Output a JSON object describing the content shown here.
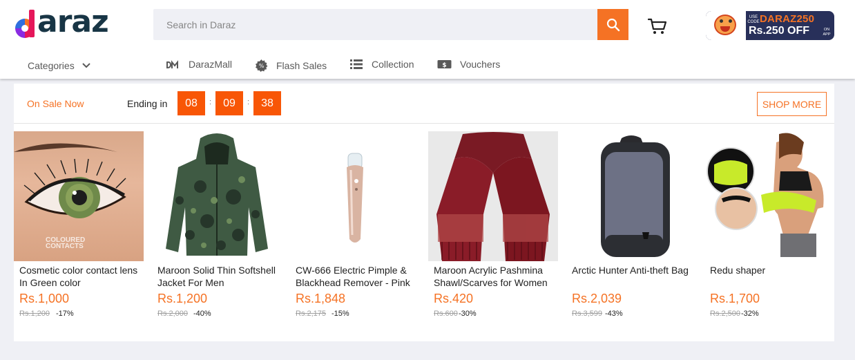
{
  "header": {
    "logo_text": "daraz",
    "search_placeholder": "Search in Daraz",
    "promo": {
      "use_code": "USE CODE",
      "code": "DARAZ250",
      "offer": "Rs.250 OFF",
      "on_app": "ON APP"
    }
  },
  "nav": {
    "categories_label": "Categories",
    "items": [
      {
        "label": "DarazMall",
        "icon": "darazmall-icon"
      },
      {
        "label": "Flash Sales",
        "icon": "flash-sale-icon"
      },
      {
        "label": "Collection",
        "icon": "collection-list-icon"
      },
      {
        "label": "Vouchers",
        "icon": "voucher-icon"
      }
    ]
  },
  "flash_sale": {
    "on_sale_label": "On Sale Now",
    "ending_label": "Ending in",
    "timer": {
      "hours": "08",
      "minutes": "09",
      "seconds": "38"
    },
    "separator": ":",
    "shop_more_label": "SHOP MORE"
  },
  "products": [
    {
      "name": "Cosmetic color contact lens In Green color",
      "price": "Rs.1,000",
      "original_price": "Rs.1,200",
      "discount": "-17%"
    },
    {
      "name": "Maroon Solid Thin Softshell Jacket For Men",
      "price": "Rs.1,200",
      "original_price": "Rs.2,000",
      "discount": "-40%"
    },
    {
      "name": "CW-666 Electric Pimple & Blackhead Remover - Pink",
      "price": "Rs.1,848",
      "original_price": "Rs.2,175",
      "discount": "-15%"
    },
    {
      "name": "Maroon Acrylic Pashmina Shawl/Scarves for Women",
      "price": "Rs.420",
      "original_price": "Rs.600",
      "discount": "-30%"
    },
    {
      "name": "Arctic Hunter Anti-theft Bag",
      "price": "Rs.2,039",
      "original_price": "Rs.3,599",
      "discount": "-43%"
    },
    {
      "name": "Redu shaper",
      "price": "Rs.1,700",
      "original_price": "Rs.2,500",
      "discount": "-32%"
    }
  ],
  "watermark": "COLOURED CONTACTS",
  "colors": {
    "brand_orange": "#f57224",
    "timer_orange": "#f85606",
    "page_bg": "#eff0f5",
    "logo_navy": "#183545"
  }
}
